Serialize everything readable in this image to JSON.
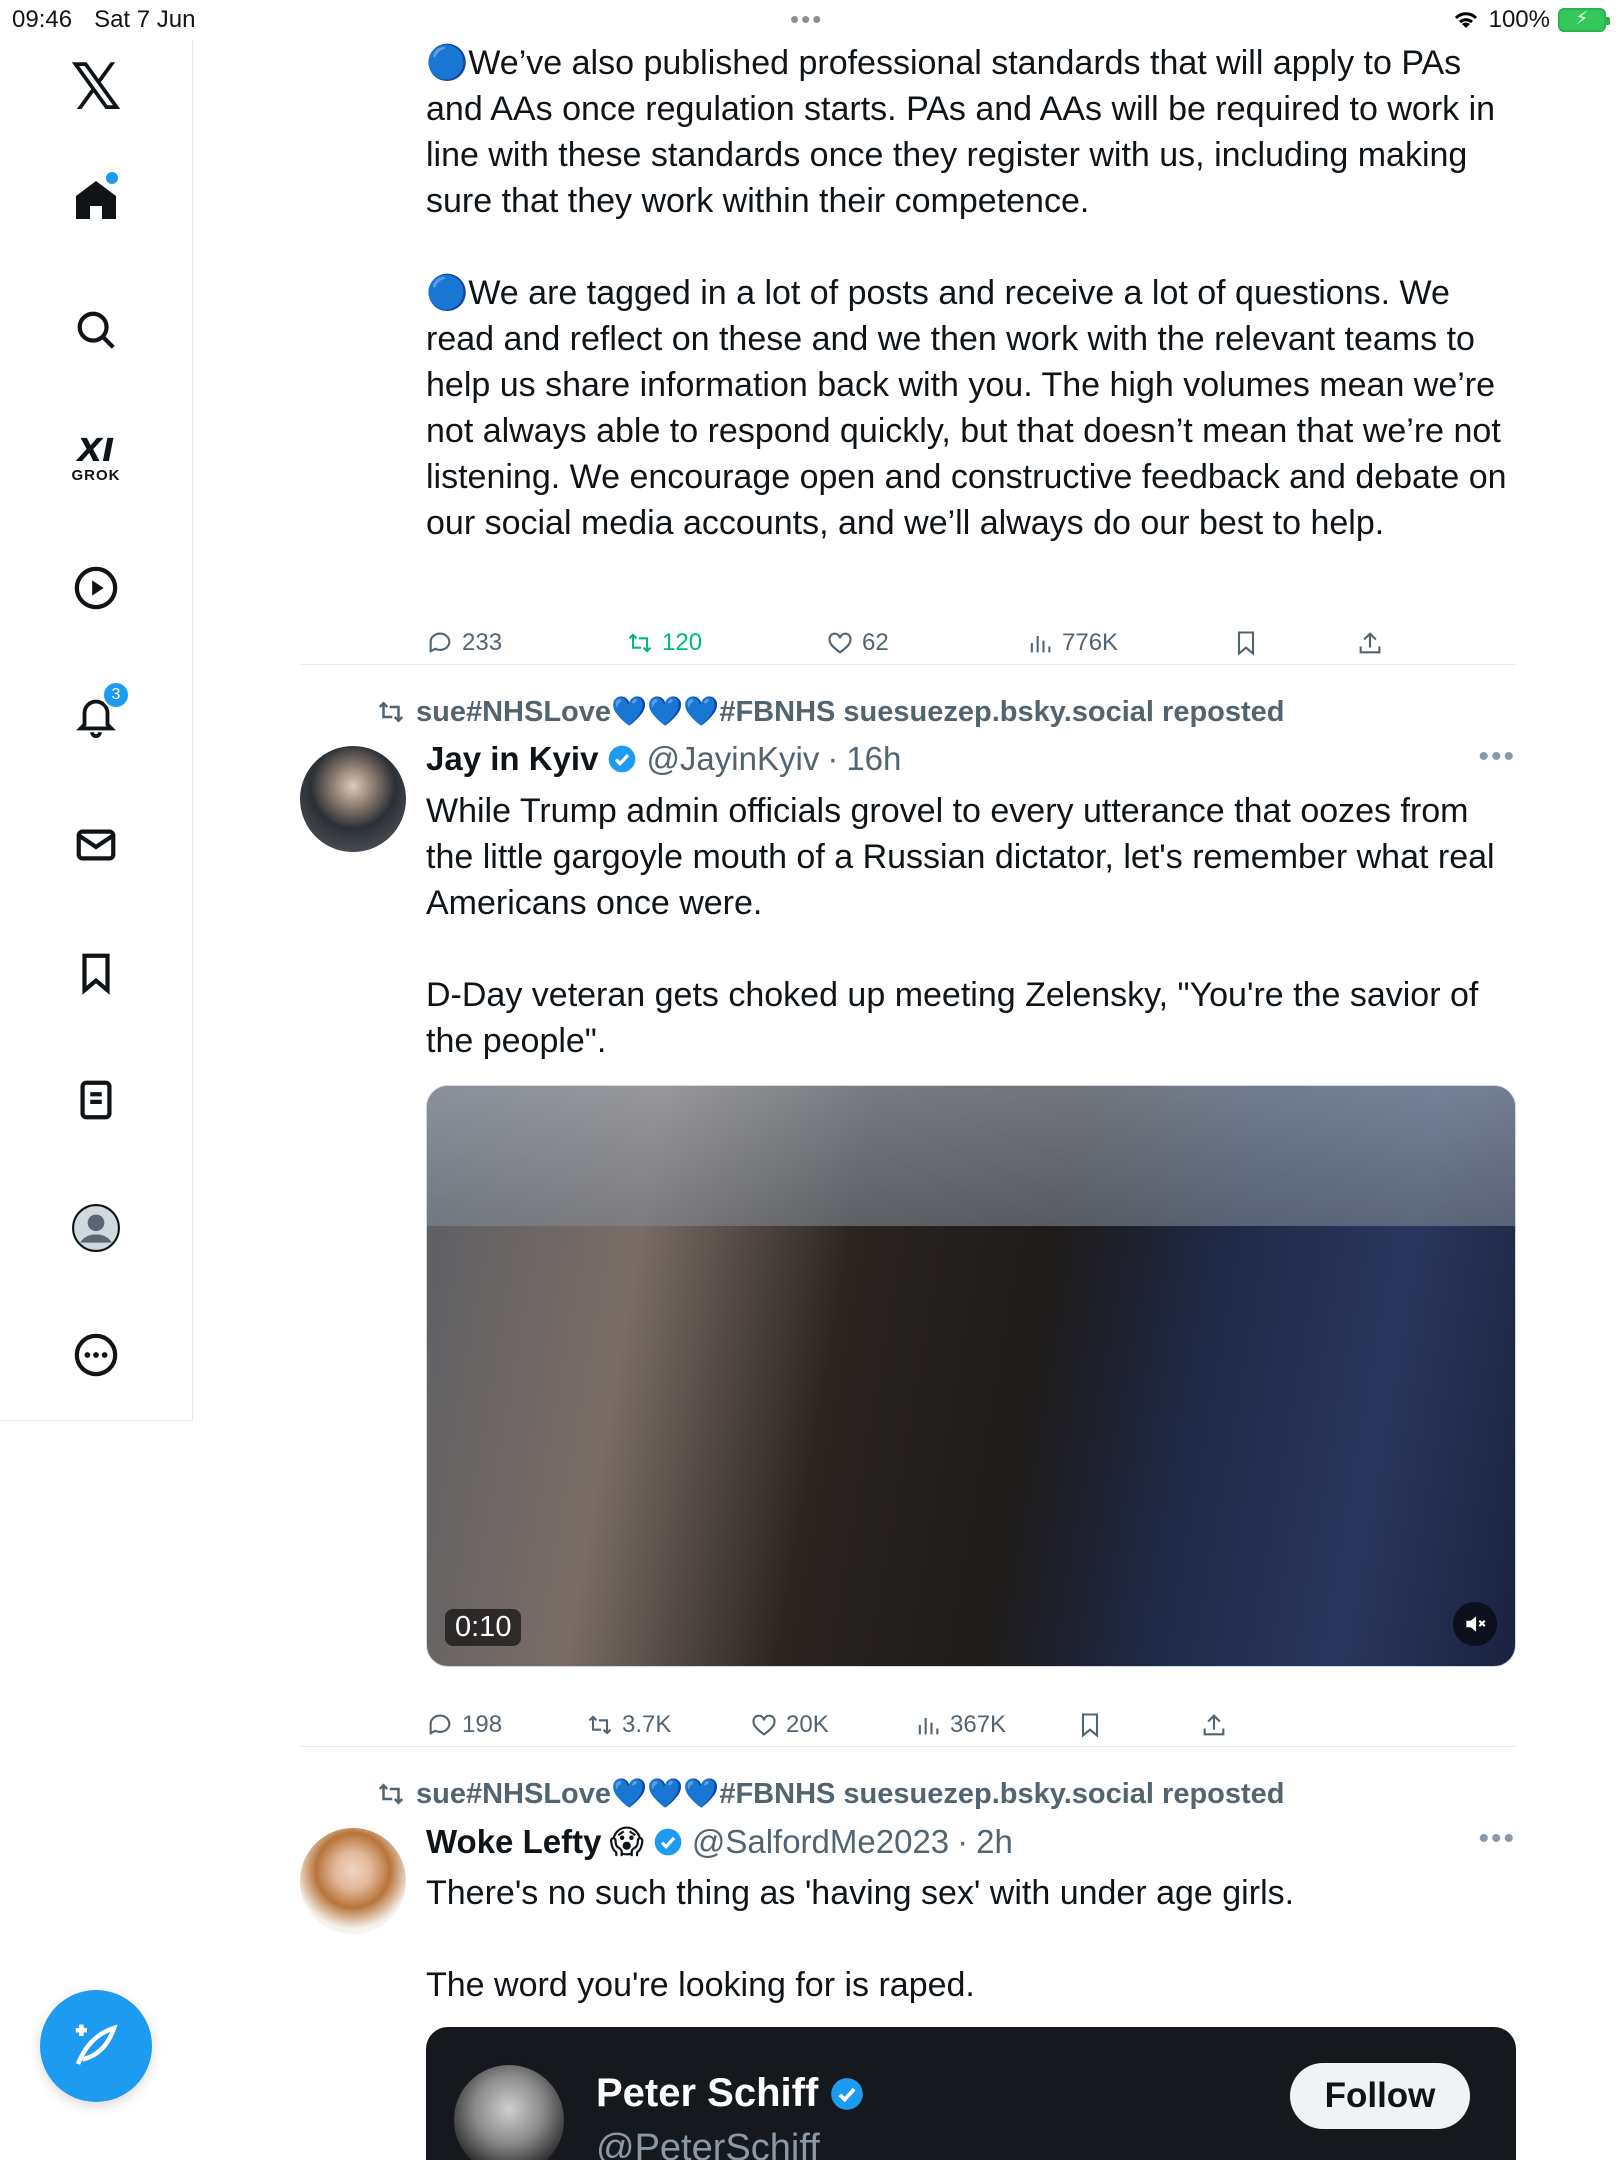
{
  "status": {
    "time": "09:46",
    "date": "Sat 7 Jun",
    "battery": "100%"
  },
  "sidebar": {
    "notifications_badge": "3",
    "grok_label": "GROK"
  },
  "post1": {
    "text": "🔵We’ve also published professional standards that will apply to PAs and AAs once regulation starts. PAs and AAs will be required to work in line with these standards once they register with us, including making sure that they work within their competence.\n\n🔵We are tagged in a lot of posts and receive a lot of questions. We read and reflect on these and we then work with the relevant teams to help us share information back with you. The high volumes mean we’re not always able to respond quickly, but that doesn’t mean that we’re not listening. We encourage open and constructive feedback and debate on our social media accounts, and we’ll always do our best to help.",
    "replies": "233",
    "reposts": "120",
    "likes": "62",
    "views": "776K"
  },
  "post2": {
    "repost_label": "sue#NHSLove💙💙💙#FBNHS suesuezep.bsky.social reposted",
    "name": "Jay in Kyiv",
    "handle": "@JayinKyiv",
    "time": "16h",
    "text": "While Trump admin officials grovel to every utterance that oozes from the little gargoyle mouth of a Russian dictator, let's remember what real Americans once were.\n\nD-Day veteran gets choked up meeting Zelensky, \"You're the savior of the people\".",
    "video_duration": "0:10",
    "replies": "198",
    "reposts": "3.7K",
    "likes": "20K",
    "views": "367K"
  },
  "post3": {
    "repost_label": "sue#NHSLove💙💙💙#FBNHS suesuezep.bsky.social reposted",
    "name": "Woke Lefty",
    "name_emoji": "😱",
    "handle": "@SalfordMe2023",
    "time": "2h",
    "text": "There's no such thing as 'having sex' with under age girls.\n\nThe word you're looking for is raped.",
    "embed_name": "Peter Schiff",
    "embed_handle": "@PeterSchiff",
    "embed_follow": "Follow"
  },
  "colors": {
    "accent": "#1d9bf0",
    "repost_green": "#00ba7c",
    "muted": "#536471"
  }
}
